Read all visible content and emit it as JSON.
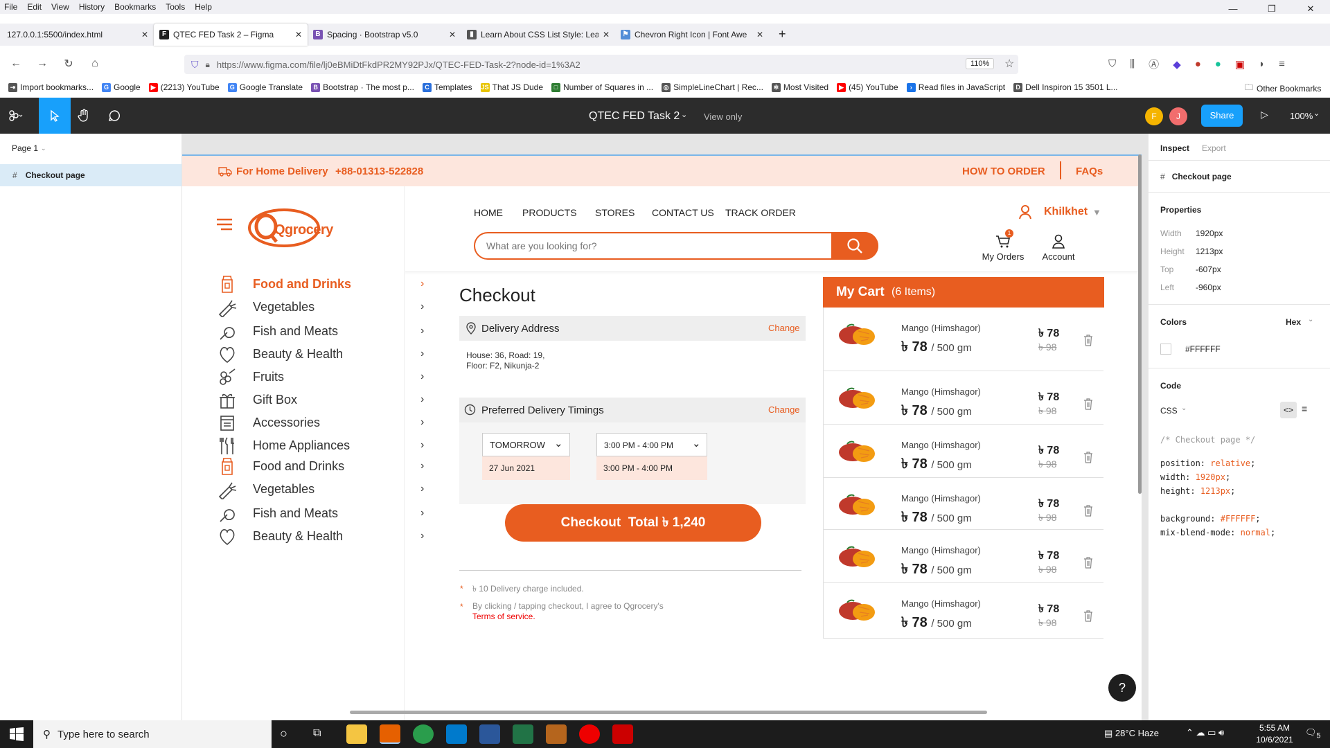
{
  "browser": {
    "menu": [
      "File",
      "Edit",
      "View",
      "History",
      "Bookmarks",
      "Tools",
      "Help"
    ],
    "tabs": [
      {
        "title": "127.0.0.1:5500/index.html",
        "fav": "",
        "fav_color": "#f0f0f4"
      },
      {
        "title": "QTEC FED Task 2 – Figma",
        "fav": "F",
        "fav_color": "#1e1e1e"
      },
      {
        "title": "Spacing · Bootstrap v5.0",
        "fav": "B",
        "fav_color": "#7952b3"
      },
      {
        "title": "Learn About CSS List Style: Lear",
        "fav": "▮",
        "fav_color": "#555"
      },
      {
        "title": "Chevron Right Icon | Font Awe",
        "fav": "⚑",
        "fav_color": "#528dd7"
      }
    ],
    "url": "https://www.figma.com/file/lj0eBMiDtFkdPR2MY92PJx/QTEC-FED-Task-2?node-id=1%3A2",
    "url_host": "figma.com",
    "zoom": "110%",
    "bookmarks": [
      {
        "label": "Import bookmarks...",
        "ico": "⇥",
        "color": "#555"
      },
      {
        "label": "Google",
        "ico": "G",
        "color": "#4285f4"
      },
      {
        "label": "(2213) YouTube",
        "ico": "▶",
        "color": "#ff0000"
      },
      {
        "label": "Google Translate",
        "ico": "G",
        "color": "#4285f4"
      },
      {
        "label": "Bootstrap · The most p...",
        "ico": "B",
        "color": "#7952b3"
      },
      {
        "label": "Templates",
        "ico": "C",
        "color": "#2a6fdb"
      },
      {
        "label": "That JS Dude",
        "ico": "JS",
        "color": "#e8c400"
      },
      {
        "label": "Number of Squares in ...",
        "ico": "□",
        "color": "#2e7d32"
      },
      {
        "label": "SimpleLineChart | Rec...",
        "ico": "◎",
        "color": "#555"
      },
      {
        "label": "Most Visited",
        "ico": "✲",
        "color": "#555"
      },
      {
        "label": "(45) YouTube",
        "ico": "▶",
        "color": "#ff0000"
      },
      {
        "label": "Read files in JavaScript",
        "ico": "›",
        "color": "#1a73e8"
      },
      {
        "label": "Dell Inspiron 15 3501 L...",
        "ico": "D",
        "color": "#555"
      }
    ],
    "other_bookmarks": "Other Bookmarks"
  },
  "figma": {
    "file_title": "QTEC FED Task 2",
    "view_only": "View only",
    "avatars": [
      {
        "letter": "F",
        "color": "#f5b400"
      },
      {
        "letter": "J",
        "color": "#f26d6d"
      }
    ],
    "share": "Share",
    "zoom": "100%",
    "page": "Page 1",
    "layer": "Checkout page",
    "inspect": {
      "tab_inspect": "Inspect",
      "tab_export": "Export",
      "frame_name": "Checkout page",
      "properties_title": "Properties",
      "props": [
        {
          "label": "Width",
          "value": "1920px"
        },
        {
          "label": "Height",
          "value": "1213px"
        },
        {
          "label": "Top",
          "value": "-607px"
        },
        {
          "label": "Left",
          "value": "-960px"
        }
      ],
      "colors_title": "Colors",
      "color_format": "Hex",
      "color_value": "#FFFFFF",
      "code_title": "Code",
      "code_lang": "CSS",
      "code_comment": "/* Checkout page */",
      "code_lines": [
        {
          "prop": "position:",
          "val": "relative"
        },
        {
          "prop": "width:",
          "val": "1920px"
        },
        {
          "prop": "height:",
          "val": "1213px"
        },
        {
          "prop": "background:",
          "val": "#FFFFFF"
        },
        {
          "prop": "mix-blend-mode:",
          "val": "normal"
        }
      ]
    }
  },
  "site": {
    "accent": "#e85d20",
    "delivery_label": "For Home Delivery",
    "delivery_phone": "+88-01313-522828",
    "how_to_order": "HOW TO ORDER",
    "faqs": "FAQs",
    "logo": "Qgrocery",
    "nav": [
      "HOME",
      "PRODUCTS",
      "STORES",
      "CONTACT US",
      "TRACK ORDER"
    ],
    "location": "Khilkhet",
    "search_placeholder": "What are you looking for?",
    "my_orders": "My Orders",
    "orders_badge": "1",
    "account": "Account",
    "categories": [
      {
        "label": "Food and Drinks",
        "icon": "food-drinks-icon",
        "active": true
      },
      {
        "label": "Vegetables",
        "icon": "vegetables-icon"
      },
      {
        "label": "Fish and Meats",
        "icon": "fish-meats-icon"
      },
      {
        "label": "Beauty & Health",
        "icon": "beauty-health-icon"
      },
      {
        "label": "Fruits",
        "icon": "fruits-icon"
      },
      {
        "label": "Gift Box",
        "icon": "gift-box-icon"
      },
      {
        "label": "Accessories",
        "icon": "accessories-icon"
      },
      {
        "label": "Home Appliances",
        "icon": "home-appliances-icon"
      },
      {
        "label": "Food and Drinks",
        "icon": "food-drinks-icon"
      },
      {
        "label": "Vegetables",
        "icon": "vegetables-icon"
      },
      {
        "label": "Fish and Meats",
        "icon": "fish-meats-icon"
      },
      {
        "label": "Beauty & Health",
        "icon": "beauty-health-icon"
      }
    ],
    "checkout": {
      "title": "Checkout",
      "delivery_address_label": "Delivery Address",
      "change": "Change",
      "address_line1": "House: 36, Road: 19,",
      "address_line2": "Floor: F2, Nikunja-2",
      "timings_label": "Preferred Delivery Timings",
      "day_select": "TOMORROW",
      "day_value": "27 Jun 2021",
      "time_select": "3:00 PM - 4:00 PM",
      "time_value": "3:00 PM - 4:00 PM",
      "checkout_button": "Checkout  Total ৳ 1,240",
      "note1": "৳ 10 Delivery charge included.",
      "note2": "By clicking / tapping checkout, I agree to Qgrocery's",
      "terms": "Terms of service."
    },
    "cart": {
      "title": "My Cart",
      "count": "(6 Items)",
      "items": [
        {
          "name": "Mango (Himshagor)",
          "price": "৳ 78",
          "unit": "/ 500 gm",
          "new_price": "৳ 78",
          "old_price": "৳ 98"
        },
        {
          "name": "Mango (Himshagor)",
          "price": "৳ 78",
          "unit": "/ 500 gm",
          "new_price": "৳ 78",
          "old_price": "৳ 98"
        },
        {
          "name": "Mango (Himshagor)",
          "price": "৳ 78",
          "unit": "/ 500 gm",
          "new_price": "৳ 78",
          "old_price": "৳ 98"
        },
        {
          "name": "Mango (Himshagor)",
          "price": "৳ 78",
          "unit": "/ 500 gm",
          "new_price": "৳ 78",
          "old_price": "৳ 98"
        },
        {
          "name": "Mango (Himshagor)",
          "price": "৳ 78",
          "unit": "/ 500 gm",
          "new_price": "৳ 78",
          "old_price": "৳ 98"
        },
        {
          "name": "Mango (Himshagor)",
          "price": "৳ 78",
          "unit": "/ 500 gm",
          "new_price": "৳ 78",
          "old_price": "৳ 98"
        }
      ]
    }
  },
  "taskbar": {
    "search": "Type here to search",
    "weather": "28°C  Haze",
    "time": "5:55 AM",
    "date": "10/6/2021",
    "notif": "5"
  }
}
